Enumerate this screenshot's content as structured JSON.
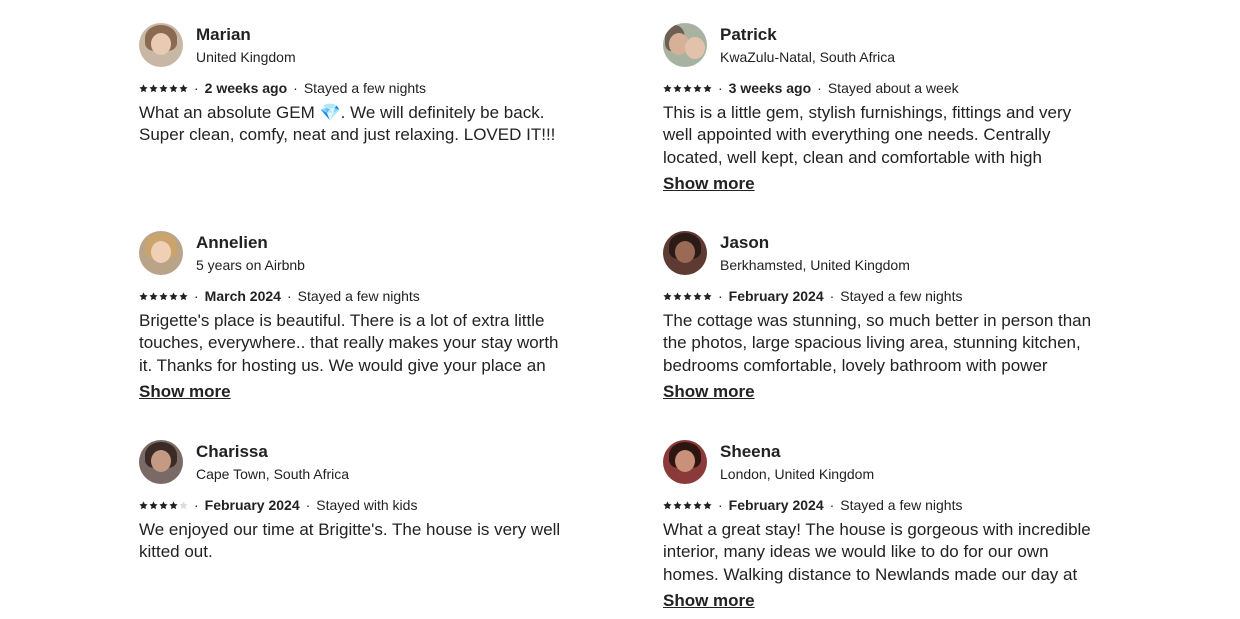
{
  "reviews": [
    {
      "name": "Marian",
      "location": "United Kingdom",
      "rating": 5,
      "when": "2 weeks ago",
      "stay": "Stayed a few nights",
      "text": "What an absolute GEM 💎. We will definitely be back. Super clean, comfy, neat and just relaxing. LOVED IT!!!",
      "show_more": ""
    },
    {
      "name": "Patrick",
      "location": "KwaZulu-Natal, South Africa",
      "rating": 5,
      "when": "3 weeks ago",
      "stay": "Stayed about a week",
      "text": "This is a little gem, stylish furnishings, fittings and very well appointed with everything one needs. Centrally located, well kept, clean and comfortable with high quality linen. Enjoyed",
      "show_more": "Show more"
    },
    {
      "name": "Annelien",
      "location": "5 years on Airbnb",
      "rating": 5,
      "when": "March 2024",
      "stay": "Stayed a few nights",
      "text": "Brigette's place is beautiful. There is a lot of extra little touches, everywhere.. that really makes your stay worth it. Thanks for hosting us. We would give your place an absolute",
      "show_more": "Show more"
    },
    {
      "name": "Jason",
      "location": "Berkhamsted, United Kingdom",
      "rating": 5,
      "when": "February 2024",
      "stay": "Stayed a few nights",
      "text": "The cottage was stunning, so much better in person than the photos, large spacious living area, stunning kitchen, bedrooms comfortable, lovely bathroom with power shower. Super clean",
      "show_more": "Show more"
    },
    {
      "name": "Charissa",
      "location": "Cape Town, South Africa",
      "rating": 4,
      "when": "February 2024",
      "stay": "Stayed with kids",
      "text": "We enjoyed our time at Brigitte's. The house is very well kitted out.",
      "show_more": ""
    },
    {
      "name": "Sheena",
      "location": "London, United Kingdom",
      "rating": 5,
      "when": "February 2024",
      "stay": "Stayed a few nights",
      "text": "What a great stay! The house is gorgeous with incredible interior, many ideas we would like to do for our own homes. Walking distance to Newlands made our day at the cricket",
      "show_more": "Show more"
    }
  ],
  "colors": {
    "text": "#222222",
    "star": "#222222",
    "star_empty": "#dddddd"
  }
}
